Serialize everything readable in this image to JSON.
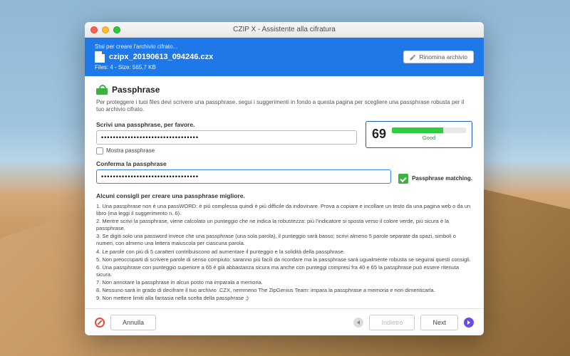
{
  "window": {
    "title": "CZIP X - Assistente alla cifratura"
  },
  "header": {
    "creating": "Stai per creare l'archivio cifrato...",
    "filename": "czipx_20190613_094246.czx",
    "stats": "Files: 4 - Size: 565,7 KB",
    "rename": "Rinomina archivio"
  },
  "main": {
    "title": "Passphrase",
    "intro": "Per proteggere i tuoi files devi scrivere una passphrase. segui i suggerimenti in fondo a questa pagina per scegliere una passphrase robusta per il tuo archivio cifrato.",
    "pass_label": "Scrivi una passphrase, per favore.",
    "pass_value": "•••••••••••••••••••••••••••••••••",
    "show_pass": "Mostra passphrase",
    "confirm_label": "Conferma la passphrase",
    "confirm_value": "•••••••••••••••••••••••••••••••••",
    "matching": "Passphrase matching."
  },
  "strength": {
    "score": "69",
    "label": "Good"
  },
  "tips": {
    "heading": "Alcuni consigli per creare una passphrase migliore.",
    "items": [
      "1. Una passphrase non è una passWORD: è più complessa quindi è più difficile da indovinare. Prova a copiare e incollare un testo da una pagina web o da un libro (ma leggi il suggerimento n. 6).",
      "2. Mentre scrivi la passphrase, viene calcolato un punteggio che ne indica la robustezza: più l'indicatore si sposta verso il colore verde, più sicura è la passphrase.",
      "3. Se digiti solo una password invece che una passphrase (una sola parola), il punteggio sarà basso; scrivi almeno 5 parole separate da spazi, simboli o numeri, con almeno una lettera maiuscola per ciascuna parola.",
      "4. Le parole con più di 5 caratteri contribuiscono ad aumentare il punteggio e la solidità della passphrase.",
      "5. Non preoccuparti di scrivere parole di senso compiuto: saranno più facili da ricordare ma la passphrase sarà ugualmente robusta se seguirai questi consigli.",
      "6. Una passphrase con punteggio superiore a 65 è già abbastanza sicura ma anche con punteggi compresi fra 40 e 65 la passphrase può essere ritenuta sicura.",
      "7. Non annotare la passphrase in alcun posto ma imparala a memoria.",
      "8. Nessuno sarà in grado di decifrare il tuo archivio .CZX, nemmeno The ZipGenius Team: impara la passphrase a memoria e non dimenticarla.",
      "9. Non mettere limiti alla fantasia nella scelta della passphrase ;)"
    ]
  },
  "footer": {
    "cancel": "Annulla",
    "back": "Indietro",
    "next": "Next"
  }
}
